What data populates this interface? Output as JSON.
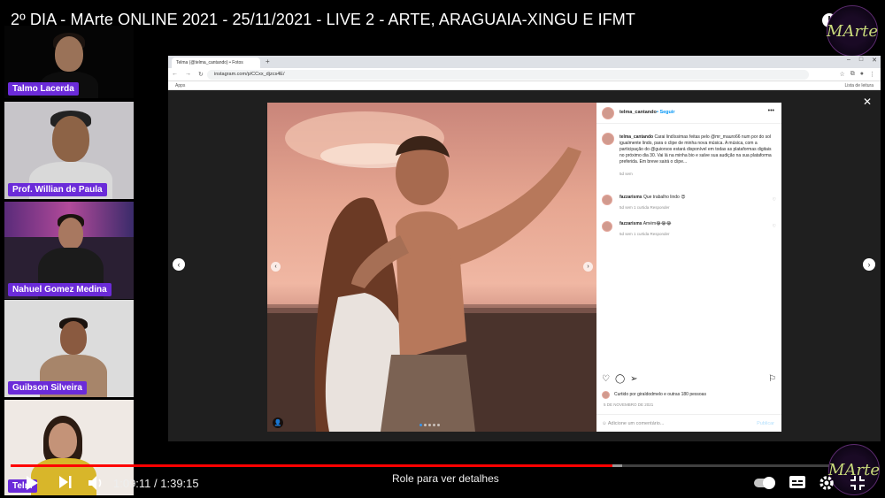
{
  "video": {
    "title": "2º DIA - MArte ONLINE 2021 - 25/11/2021 - LIVE 2 - ARTE, ARAGUAIA-XINGU E IFMT",
    "logo_text": "MArte"
  },
  "participants": [
    {
      "name": "Talmo Lacerda"
    },
    {
      "name": "Prof. Willian de Paula"
    },
    {
      "name": "Nahuel Gomez Medina"
    },
    {
      "name": "Guibson Silveira"
    },
    {
      "name": "Telm"
    }
  ],
  "browser": {
    "tab_title": "Telma (@telma_cantando) • Fotos",
    "new_tab": "+",
    "url": "instagram.com/p/CCxx_djzcs4E/",
    "bookmarks_apps": "Apps",
    "bookmarks_right": "Lista de leitura"
  },
  "instagram": {
    "username": "telma_cantando",
    "follow_label": "• Seguir",
    "caption_user": "telma_cantando",
    "caption_text": "Carai lindíssimas feitas pelo @mr_mauro66 num por do sol igualmente lindo, para o clipe de minha nova música. A música, com a participação do @guiorsos estará disponível em todas as plataformas digitais no próximo dia 30. Vai lá na minha bio e salve sua audição na sua plataforma preferida. Em breve sairá o clipe...",
    "caption_time": "5d sem",
    "comments": [
      {
        "user": "fazzarisms",
        "text": "Que trabalho lindo 😍",
        "meta": "5d sem   1 curtida   Responder"
      },
      {
        "user": "fazzarisms",
        "text": "Amém😂😂😂",
        "meta": "5d sem   1 curtida   Responder"
      }
    ],
    "likes_text": "Curtido por giraldodmelo e outras 180 pessoas",
    "date_text": "5 DE NOVEMBRO DE 2021",
    "comment_placeholder": "Adicione um comentário...",
    "publish_label": "Publicar"
  },
  "player": {
    "current_time": "1:09:11",
    "duration": "1:39:15",
    "time_display": "1:09:11 / 1:39:15",
    "played_fraction": 0.697,
    "buffered_fraction": 0.708,
    "scroll_hint": "Role para ver detalhes"
  }
}
